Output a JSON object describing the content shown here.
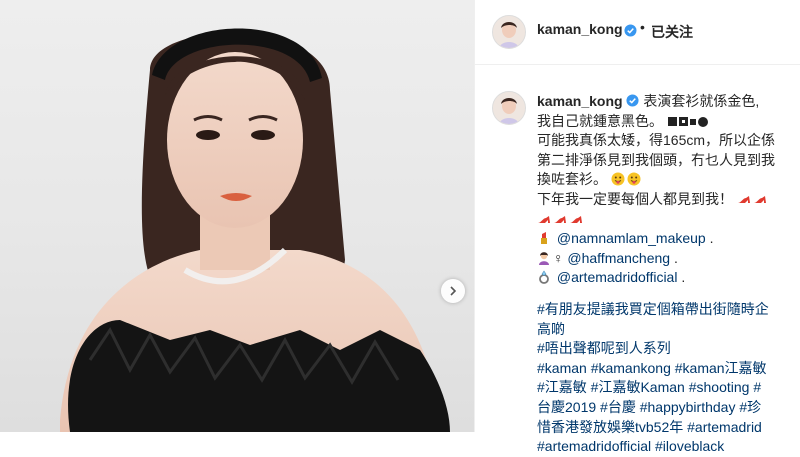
{
  "photo": {
    "alt_name": "post-photo"
  },
  "header": {
    "username": "kaman_kong",
    "separator": "•",
    "follow_label": "已关注"
  },
  "caption": {
    "username": "kaman_kong",
    "line1": "表演套衫就係金色,",
    "line2_text": "我自己就鍾意黑色。",
    "line3": "可能我真係太矮，得165cm，所以企係",
    "line4": "第二排淨係見到我個頭，冇乜人見到我",
    "line5": "換咗套衫。",
    "line6": "下年我一定要每個人都見到我！",
    "mention1": "@namnamlam_makeup",
    "mention1_suffix": " .",
    "mention2_prefix": "♀",
    "mention2": "@haffmancheng",
    "mention2_suffix": " .",
    "mention3": "@artemadridofficial",
    "mention3_suffix": " .",
    "hashtags": [
      "#有朋友提議我買定個箱帶出街隨時企",
      "高啲",
      "#唔出聲都呢到人系列",
      "#kaman #kamankong #kaman江嘉敏",
      "#江嘉敏 #江嘉敏Kaman #shooting #",
      "台慶2019 #台慶 #happybirthday #珍",
      "惜香港發放娛樂tvb52年 #artemadrid",
      "#artemadridofficial #iloveblack"
    ]
  },
  "colors": {
    "link": "#00376b",
    "verified": "#3897f0",
    "text": "#262626",
    "heel": "#e03a2f"
  },
  "icons": {
    "verified": "verified-badge-icon",
    "next": "chevron-right-icon",
    "heel": "high-heel-emoji-icon",
    "face": "tongue-face-emoji-icon",
    "lipstick": "lipstick-emoji-icon",
    "woman": "woman-emoji-icon",
    "ring": "ring-emoji-icon"
  }
}
